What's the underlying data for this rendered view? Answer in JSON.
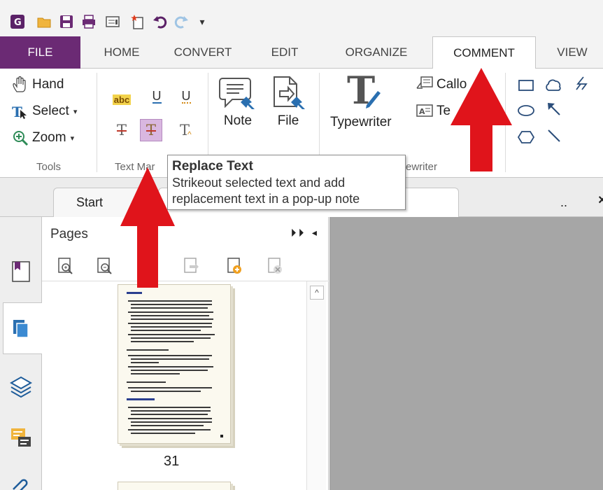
{
  "quick_access": {
    "icons": [
      "app-logo-icon",
      "open-folder-icon",
      "save-icon",
      "print-icon",
      "properties-icon",
      "new-icon",
      "undo-icon",
      "redo-icon",
      "customize-qat-icon"
    ],
    "customize_glyph": "▾"
  },
  "ribbon_tabs": {
    "file": "FILE",
    "home": "HOME",
    "convert": "CONVERT",
    "edit": "EDIT",
    "organize": "ORGANIZE",
    "comment": "COMMENT",
    "view": "VIEW"
  },
  "active_tab": "COMMENT",
  "tools_group": {
    "hand": "Hand",
    "select": "Select",
    "zoom": "Zoom",
    "name": "Tools"
  },
  "text_markup_group": {
    "name_visible": "Text Mar",
    "highlight_glyph": "abc",
    "underline_glyph": "U",
    "squiggly_glyph": "U",
    "strikeout_glyph": "T",
    "replace_glyph": "T",
    "insert_glyph": "T"
  },
  "pin_group": {
    "note": "Note",
    "file": "File"
  },
  "typewriter_group": {
    "typewriter": "Typewriter",
    "callout": "Callo",
    "textbox": "Te",
    "name_visible": "ewriter"
  },
  "tooltip": {
    "title": "Replace Text",
    "line1": "Strikeout selected text and add",
    "line2": "replacement text in a pop-up note"
  },
  "doc_tabs": {
    "start": "Start",
    "doc_ellipsis": "..",
    "close": "×"
  },
  "pages_panel": {
    "title": "Pages",
    "controls": "⏵⏵ ◂",
    "page_number": "31"
  },
  "scroll_up": "^",
  "colors": {
    "file_tab_bg": "#6b2a74",
    "annotation_arrow": "#e0141b",
    "document_view_bg": "#a6a6a6"
  }
}
